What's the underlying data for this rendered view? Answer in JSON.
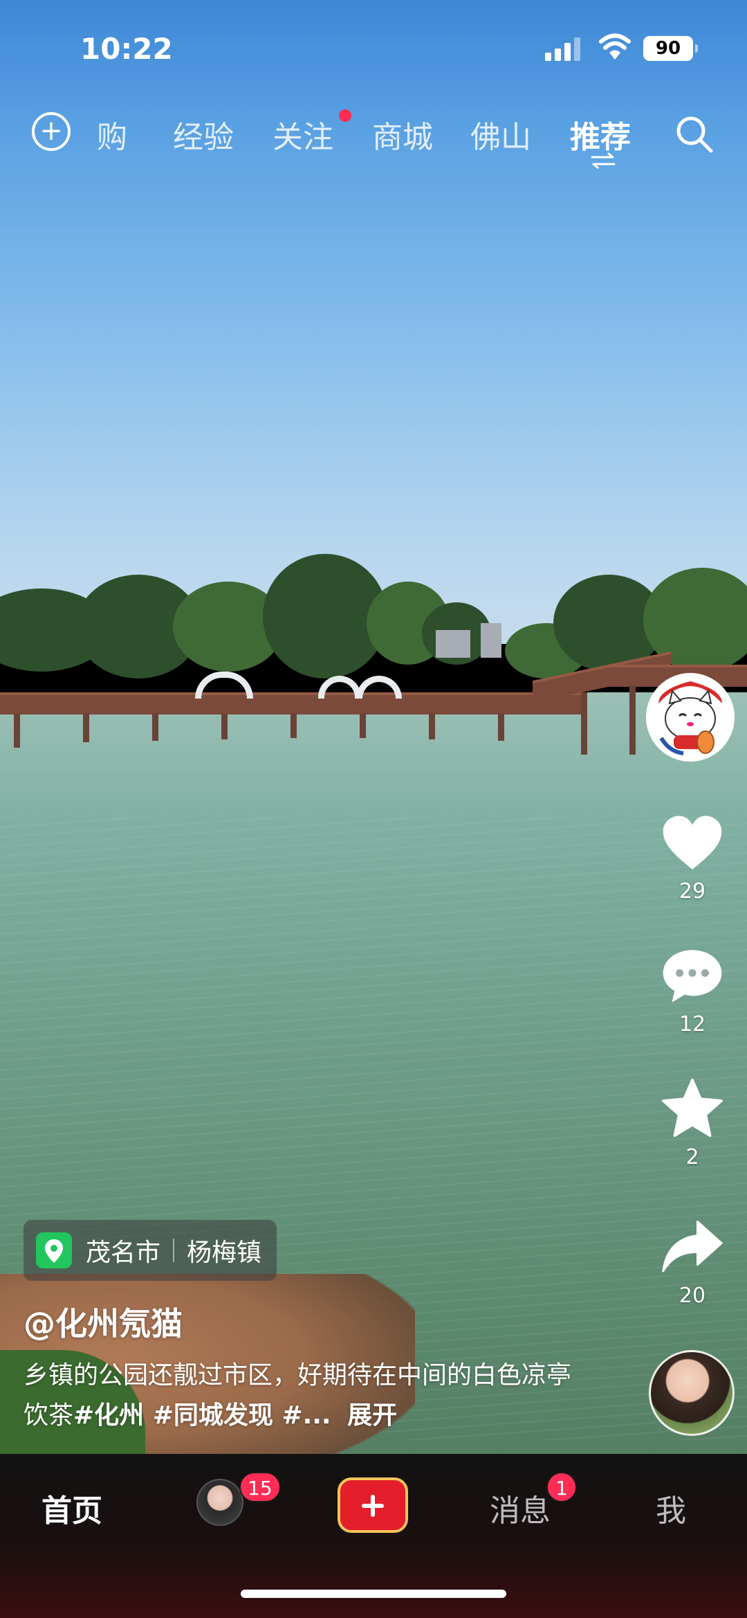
{
  "status_bar": {
    "time": "10:22",
    "battery": "90",
    "signal_icon": "cellular-signal-icon",
    "wifi_icon": "wifi-icon"
  },
  "top_nav": {
    "add_icon": "plus-circle-icon",
    "tabs": [
      {
        "label": "购",
        "active": false
      },
      {
        "label": "经验",
        "active": false
      },
      {
        "label": "关注",
        "active": false,
        "dot": true
      },
      {
        "label": "商城",
        "active": false
      },
      {
        "label": "佛山",
        "active": false
      },
      {
        "label": "推荐",
        "active": true
      }
    ],
    "switch_icon": "switch-arrows-icon",
    "search_icon": "search-icon"
  },
  "actions": {
    "like": {
      "icon": "heart-icon",
      "count": "29"
    },
    "comment": {
      "icon": "comment-icon",
      "count": "12"
    },
    "favorite": {
      "icon": "star-icon",
      "count": "2"
    },
    "share": {
      "icon": "share-icon",
      "count": "20"
    }
  },
  "location": {
    "city": "茂名市",
    "town": "杨梅镇"
  },
  "post": {
    "author": "@化州氖猫",
    "caption_text": "乡镇的公园还靓过市区，好期待在中间的白色凉亭饮茶",
    "hashtags": "#化州 #同城发现 #...",
    "expand_label": "展开"
  },
  "bottom_nav": {
    "home": "首页",
    "friends_badge": "15",
    "create_icon": "plus-icon",
    "messages": "消息",
    "messages_badge": "1",
    "me": "我"
  },
  "colors": {
    "accent_red": "#ff2d55",
    "create_button": "#e41e2b",
    "create_border": "#f6c55a",
    "location_green": "#22c55e"
  }
}
